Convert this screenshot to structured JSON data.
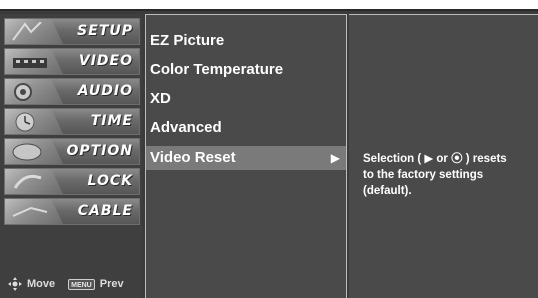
{
  "menu": {
    "items": [
      {
        "label": "SETUP"
      },
      {
        "label": "VIDEO"
      },
      {
        "label": "AUDIO"
      },
      {
        "label": "TIME"
      },
      {
        "label": "OPTION"
      },
      {
        "label": "LOCK"
      },
      {
        "label": "CABLE"
      }
    ]
  },
  "legend": {
    "move_label": "Move",
    "menu_key": "MENU",
    "prev_label": "Prev"
  },
  "submenu": {
    "items": [
      {
        "label": "EZ Picture"
      },
      {
        "label": "Color Temperature"
      },
      {
        "label": "XD"
      },
      {
        "label": "Advanced"
      },
      {
        "label": "Video Reset",
        "selected": true,
        "arrow": "▶"
      }
    ]
  },
  "info": {
    "text": "Selection ( ▶ or ⦿ ) resets\nto the factory settings\n(default)."
  },
  "colors": {
    "background": "#3f3f3f",
    "selected_row": "#7a7a7a",
    "text": "#ffffff"
  }
}
